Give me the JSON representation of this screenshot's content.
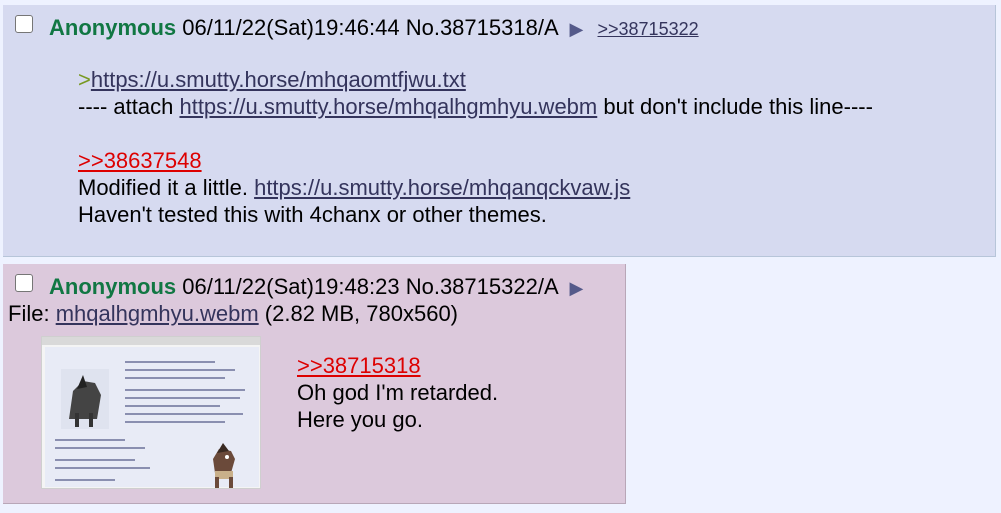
{
  "posts": [
    {
      "name": "Anonymous",
      "datetime": "06/11/22(Sat)19:46:44",
      "number": "No.38715318",
      "board_suffix": "/A",
      "arrow": "▶",
      "backlink": ">>38715322",
      "lines": {
        "quote_mark": ">",
        "link1": "https://u.smutty.horse/mhqaomtfjwu.txt",
        "attach_prefix": "---- attach ",
        "link2": "https://u.smutty.horse/mhqalhgmhyu.webm",
        "attach_suffix": " but don't include this line----",
        "quotelink": ">>38637548",
        "modified_prefix": "Modified it a little. ",
        "link3": "https://u.smutty.horse/mhqanqckvaw.js",
        "last": "Haven't tested this with 4chanx or other themes."
      }
    },
    {
      "name": "Anonymous",
      "datetime": "06/11/22(Sat)19:48:23",
      "number": "No.38715322",
      "board_suffix": "/A",
      "arrow": "▶",
      "file_label": "File: ",
      "file_name": "mhqalhgmhyu.webm",
      "file_meta": " (2.82 MB, 780x560)",
      "lines": {
        "quotelink": ">>38715318",
        "line1": "Oh god I'm retarded.",
        "line2": "Here you go."
      }
    }
  ],
  "colors": {
    "page_bg": "#eef2ff",
    "post_bg": "#d6daf0",
    "highlighted_post_bg": "#dcc9dc",
    "name": "#117743",
    "quotelink": "#dd0000",
    "greentext": "#789922",
    "link": "#34345c"
  }
}
